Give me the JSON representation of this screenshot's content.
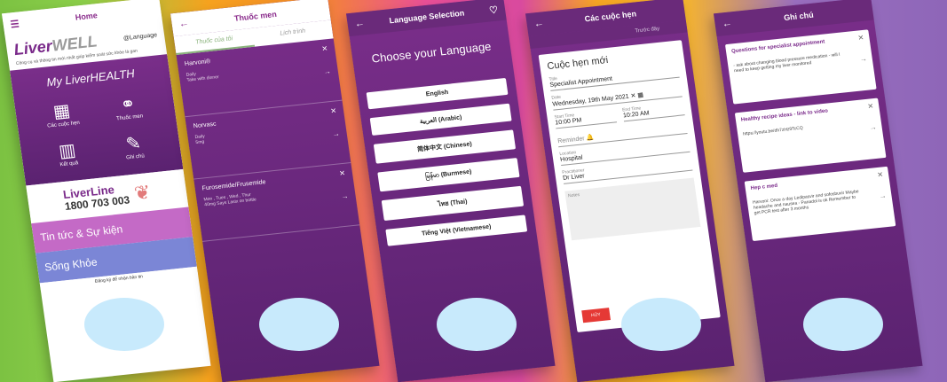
{
  "phone1": {
    "title": "Home",
    "logo": "Liver",
    "logo2": "WELL",
    "language": "@Language",
    "tagline": "Công cụ và thông tin mới nhất giúp kiểm soát sức khỏe lá gan",
    "my": "My LiverHEALTH",
    "items": [
      "Các cuộc hẹn",
      "Thuốc men",
      "Kết quả",
      "Ghi chú"
    ],
    "liverline": "LiverLine",
    "phone": "1800 703 003",
    "news": "Tin tức & Sự kiện",
    "song": "Sống Khỏe",
    "reg": "Đăng ký để nhận bản tin"
  },
  "phone2": {
    "title": "Thuốc men",
    "tab1": "Thuốc của tôi",
    "tab2": "Lịch trình",
    "meds": [
      {
        "name": "Harvoni®",
        "sub": "Daily\nTake with dinner"
      },
      {
        "name": "Norvasc",
        "sub": "Daily\n5mg"
      },
      {
        "name": "Furosemide/Frusemide",
        "sub": "Mon , Tues , Wed , Thur\n40mg Says Lasix on bottle"
      }
    ]
  },
  "phone3": {
    "title": "Language Selection",
    "choose": "Choose your Language",
    "langs": [
      "English",
      "العربية (Arabic)",
      "简体中文 (Chinese)",
      "မြန်မာ (Burmese)",
      "ไทย (Thai)",
      "Tiếng Việt (Vietnamese)"
    ]
  },
  "phone4": {
    "title": "Các cuộc hẹn",
    "tab2": "Trước đây",
    "heading": "Cuộc hẹn mới",
    "title_label": "Title",
    "title_val": "Specialist Appointment",
    "date_label": "Date",
    "date_val": "Wednesday, 19th May 2021",
    "start_label": "Start Time",
    "start_val": "10:00 PM",
    "end_label": "End Time",
    "end_val": "10:20 AM",
    "reminder": "Reminder",
    "loc_label": "Location",
    "loc_val": "Hospital",
    "prac_label": "Practitioner",
    "prac_val": "Dr Liver",
    "notes": "Notes",
    "huy": "HỦY"
  },
  "phone5": {
    "title": "Ghi chú",
    "notes": [
      {
        "t": "Questions for specialist appointment",
        "b": "- ask about changing blood pressure medication - will I need to keep getting my liver monitored"
      },
      {
        "t": "Healthy recipe ideas - link to video",
        "b": "https://youtu.be/dh7zHz9TcCQ"
      },
      {
        "t": "Hep c med",
        "b": "Harvoni: Once a day Ledipasvir and sofosbuvir Maybe headache and nausea - Panadol is ok Remember to get PCR test after 3 months"
      }
    ]
  }
}
